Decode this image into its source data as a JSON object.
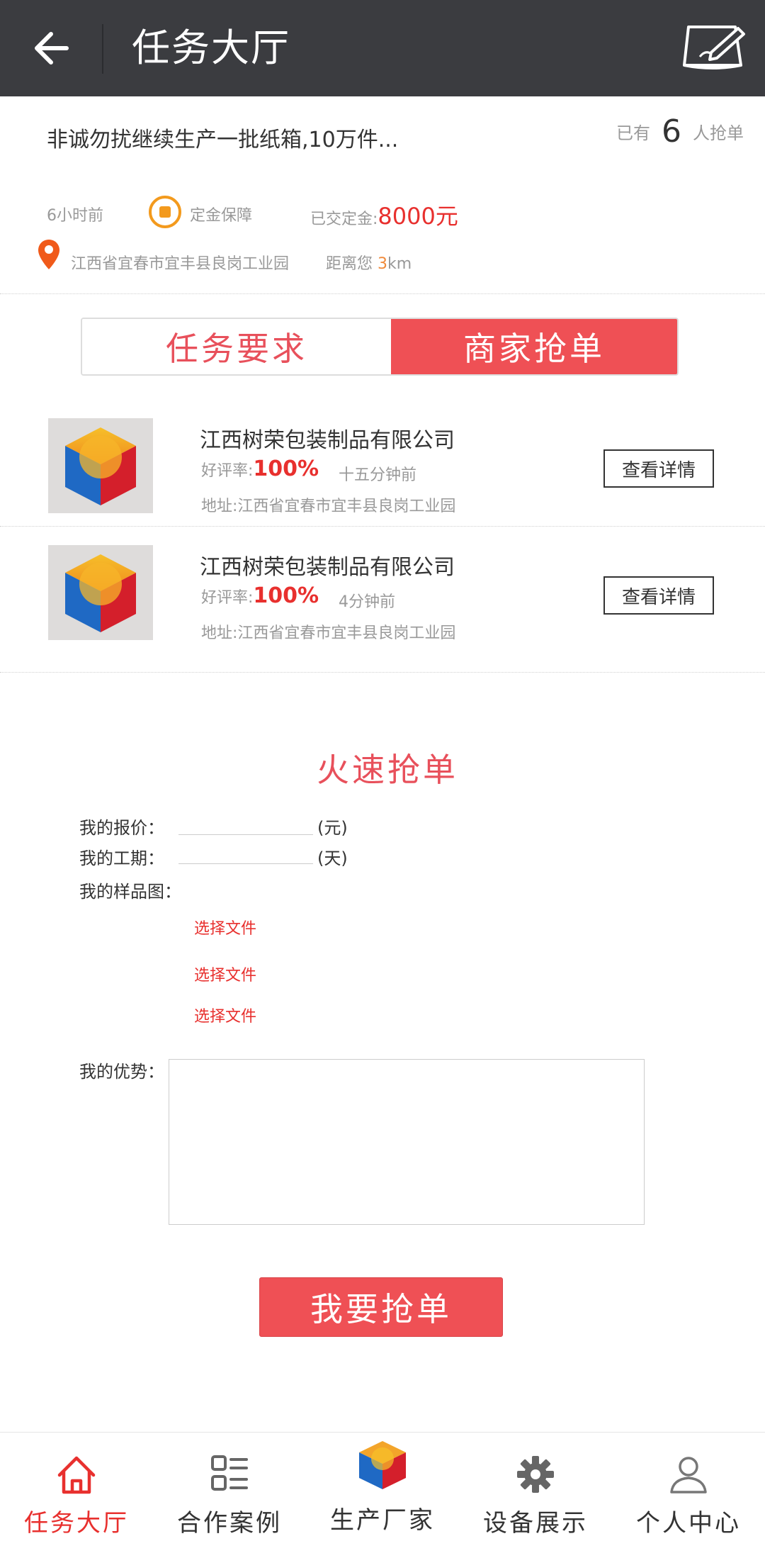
{
  "header": {
    "title": "任务大厅"
  },
  "task": {
    "title": "非诚勿扰继续生产一批纸箱,10万件...",
    "grab_prefix": "已有",
    "grab_count": "6",
    "grab_suffix": "人抢单",
    "posted_time": "6小时前",
    "deposit_label": "定金保障",
    "paid_label": "已交定金:",
    "paid_amount": "8000元",
    "location": "江西省宜春市宜丰县良岗工业园",
    "distance_label": "距离您",
    "distance_value": "3",
    "distance_unit": "km"
  },
  "tabs": [
    {
      "label": "任务要求",
      "active": false
    },
    {
      "label": "商家抢单",
      "active": true
    }
  ],
  "merchants": [
    {
      "name": "江西树荣包装制品有限公司",
      "rating_label": "好评率:",
      "rating_value": "100%",
      "time": "十五分钟前",
      "address": "地址:江西省宜春市宜丰县良岗工业园",
      "detail_label": "查看详情"
    },
    {
      "name": "江西树荣包装制品有限公司",
      "rating_label": "好评率:",
      "rating_value": "100%",
      "time": "4分钟前",
      "address": "地址:江西省宜春市宜丰县良岗工业园",
      "detail_label": "查看详情"
    }
  ],
  "form": {
    "title": "火速抢单",
    "price_label": "我的报价：",
    "price_value": "",
    "price_unit": "(元)",
    "period_label": "我的工期：",
    "period_value": "",
    "period_unit": "(天)",
    "sample_label": "我的样品图：",
    "file_buttons": [
      "选择文件",
      "选择文件",
      "选择文件"
    ],
    "advantage_label": "我的优势：",
    "advantage_value": "",
    "submit_label": "我要抢单"
  },
  "bottom_nav": [
    {
      "label": "任务大厅",
      "icon": "home-icon",
      "active": true
    },
    {
      "label": "合作案例",
      "icon": "grid-list-icon",
      "active": false
    },
    {
      "label": "生产厂家",
      "icon": "cube-logo-icon",
      "active": false
    },
    {
      "label": "设备展示",
      "icon": "gear-icon",
      "active": false
    },
    {
      "label": "个人中心",
      "icon": "user-icon",
      "active": false
    }
  ],
  "colors": {
    "header_bg": "#3b3c40",
    "accent_red": "#ef5055",
    "price_red": "#e8302e",
    "deposit_orange": "#f39a1d",
    "pin_orange": "#f05a1a"
  }
}
